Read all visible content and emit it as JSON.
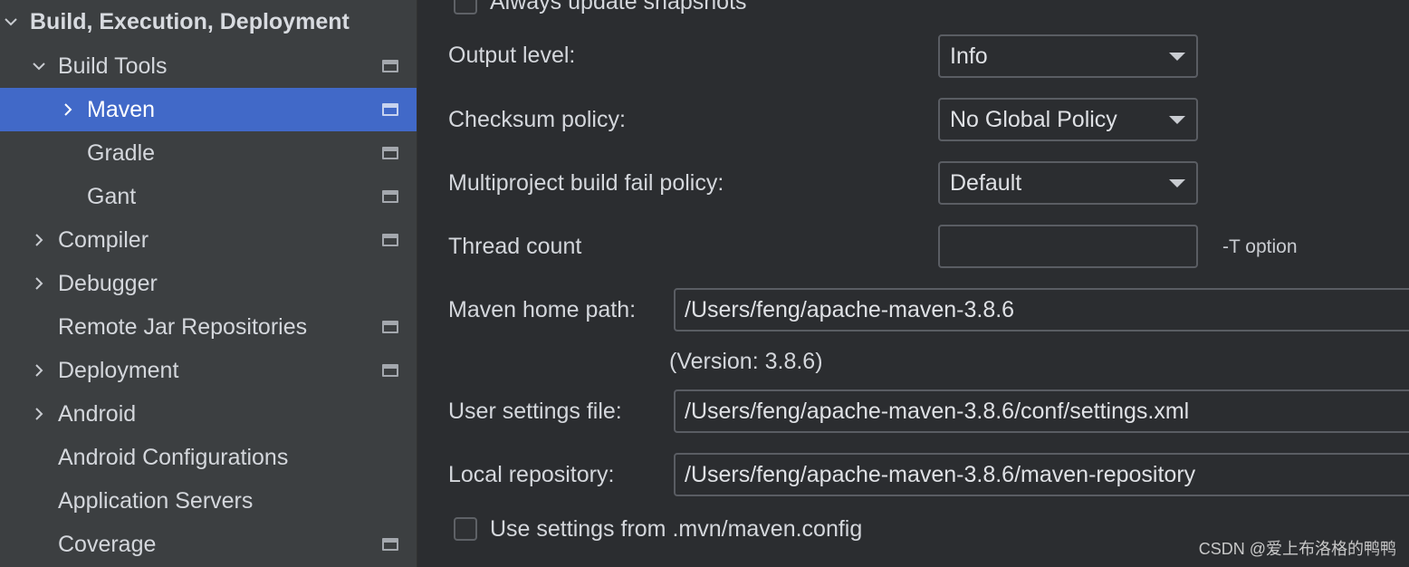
{
  "sidebar": {
    "header": {
      "label": "Build, Execution, Deployment",
      "icon": "chevron-down-icon"
    },
    "items": [
      {
        "label": "Build Tools",
        "chevron": "down",
        "has_page_icon": true
      },
      {
        "label": "Maven",
        "chevron": "right",
        "has_page_icon": true,
        "selected": true
      },
      {
        "label": "Gradle",
        "chevron": "none",
        "has_page_icon": true
      },
      {
        "label": "Gant",
        "chevron": "none",
        "has_page_icon": true
      },
      {
        "label": "Compiler",
        "chevron": "right",
        "has_page_icon": true
      },
      {
        "label": "Debugger",
        "chevron": "right",
        "has_page_icon": false
      },
      {
        "label": "Remote Jar Repositories",
        "chevron": "none",
        "has_page_icon": true
      },
      {
        "label": "Deployment",
        "chevron": "right",
        "has_page_icon": true
      },
      {
        "label": "Android",
        "chevron": "right",
        "has_page_icon": false
      },
      {
        "label": "Android Configurations",
        "chevron": "none",
        "has_page_icon": false
      },
      {
        "label": "Application Servers",
        "chevron": "none",
        "has_page_icon": false
      },
      {
        "label": "Coverage",
        "chevron": "none",
        "has_page_icon": true
      }
    ]
  },
  "form": {
    "always_update": {
      "label": "Always update snapshots",
      "checked": false
    },
    "output_level": {
      "label": "Output level:",
      "value": "Info"
    },
    "checksum_policy": {
      "label": "Checksum policy:",
      "value": "No Global Policy"
    },
    "multiproject_policy": {
      "label": "Multiproject build fail policy:",
      "value": "Default"
    },
    "thread_count": {
      "label": "Thread count",
      "value": "",
      "hint": "-T option"
    },
    "maven_home": {
      "label": "Maven home path:",
      "value": "/Users/feng/apache-maven-3.8.6",
      "version": "(Version: 3.8.6)"
    },
    "user_settings": {
      "label": "User settings file:",
      "value": "/Users/feng/apache-maven-3.8.6/conf/settings.xml"
    },
    "local_repo": {
      "label": "Local repository:",
      "value": "/Users/feng/apache-maven-3.8.6/maven-repository"
    },
    "mvn_config": {
      "label": "Use settings from .mvn/maven.config",
      "checked": false
    }
  },
  "watermark": "CSDN @爱上布洛格的鸭鸭",
  "colors": {
    "sidebar_bg": "#3c3f41",
    "main_bg": "#2b2d30",
    "selection": "#4169c8",
    "text": "#d4d7dc"
  }
}
